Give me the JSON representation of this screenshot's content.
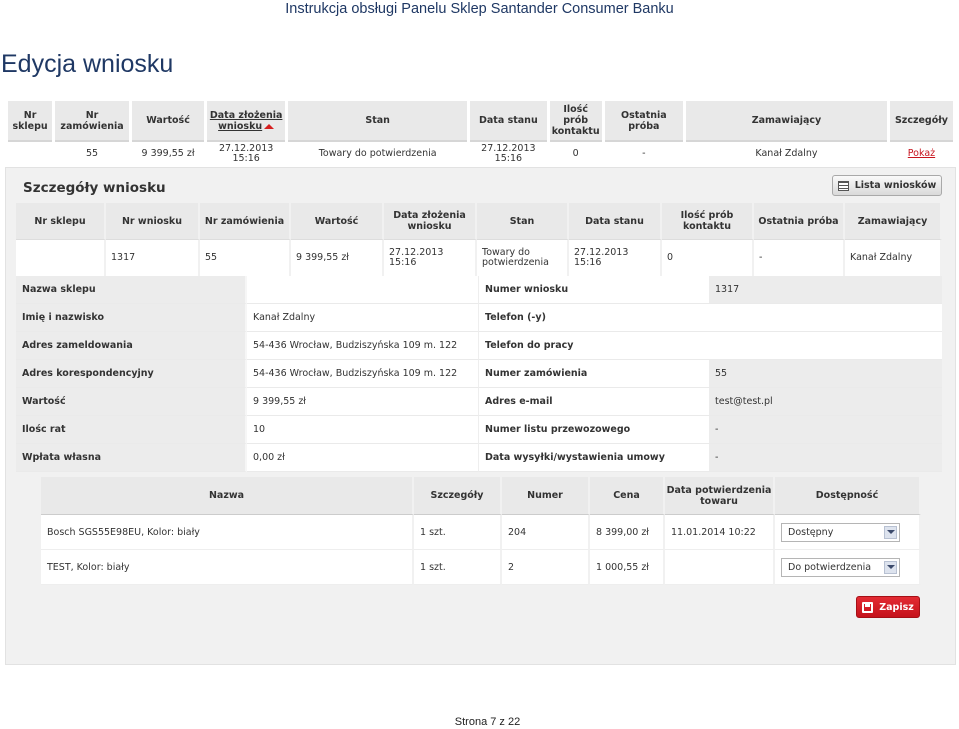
{
  "doc": {
    "header": "Instrukcja obsługi Panelu Sklep Santander Consumer Banku",
    "title": "Edycja wniosku",
    "footer": "Strona 7 z 22"
  },
  "list": {
    "headers": [
      "Nr sklepu",
      "Nr zamówienia",
      "Wartość",
      "Data złożenia wniosku",
      "Stan",
      "Data stanu",
      "Ilość prób kontaktu",
      "Ostatnia próba",
      "Zamawiający",
      "Szczegóły"
    ],
    "row": {
      "nr_sklepu": "55",
      "wartosc": "9 399,55 zł",
      "data_zlozenia": "27.12.2013 15:16",
      "stan": "Towary do potwierdzenia",
      "data_stanu": "27.12.2013 15:16",
      "ilosc_prob": "0",
      "ostatnia_proba": "-",
      "zamawiajacy": "Kanał   Zdalny",
      "szczegoly": "Pokaż"
    }
  },
  "panel": {
    "title": "Szczegóły wniosku",
    "list_button": "Lista wniosków",
    "summary_headers": [
      "Nr sklepu",
      "Nr wniosku",
      "Nr zamówienia",
      "Wartość",
      "Data złożenia wniosku",
      "Stan",
      "Data stanu",
      "Ilość prób kontaktu",
      "Ostatnia próba",
      "Zamawiający"
    ],
    "summary_row": [
      "1317",
      "55",
      "9 399,55 zł",
      "27.12.2013 15:16",
      "Towary do potwierdzenia",
      "27.12.2013 15:16",
      "0",
      "-",
      "Kanał   Zdalny"
    ],
    "details": [
      {
        "l1": "Nazwa sklepu",
        "v1": "",
        "l2": "Numer wniosku",
        "v2": "1317"
      },
      {
        "l1": "Imię i nazwisko",
        "v1": "Kanał Zdalny",
        "l2": "Telefon (-y)",
        "v2": ""
      },
      {
        "l1": "Adres zameldowania",
        "v1": "54-436 Wrocław, Budziszyńska 109 m. 122",
        "l2": "Telefon do pracy",
        "v2": ""
      },
      {
        "l1": "Adres korespondencyjny",
        "v1": "54-436 Wrocław, Budziszyńska 109 m. 122",
        "l2": "Numer zamówienia",
        "v2": "55"
      },
      {
        "l1": "Wartość",
        "v1": "9 399,55 zł",
        "l2": "Adres e-mail",
        "v2": "test@test.pl"
      },
      {
        "l1": "Ilośc rat",
        "v1": "10",
        "l2": "Numer listu przewozowego",
        "v2": "-"
      },
      {
        "l1": "Wpłata własna",
        "v1": "0,00 zł",
        "l2": "Data wysyłki/wystawienia umowy",
        "v2": "-"
      }
    ],
    "product_headers": [
      "Nazwa",
      "Szczegóły",
      "Numer",
      "Cena",
      "Data potwierdzenia towaru",
      "Dostępność"
    ],
    "products": [
      {
        "nazwa": "Bosch SGS55E98EU, Kolor: biały",
        "szczegoly": "1 szt.",
        "numer": "204",
        "cena": "8 399,00 zł",
        "data": "11.01.2014 10:22",
        "dostepnosc": "Dostępny"
      },
      {
        "nazwa": "TEST, Kolor: biały",
        "szczegoly": "1 szt.",
        "numer": "2",
        "cena": "1 000,55 zł",
        "data": "",
        "dostepnosc": "Do potwierdzenia"
      }
    ],
    "save_button": "Zapisz"
  }
}
